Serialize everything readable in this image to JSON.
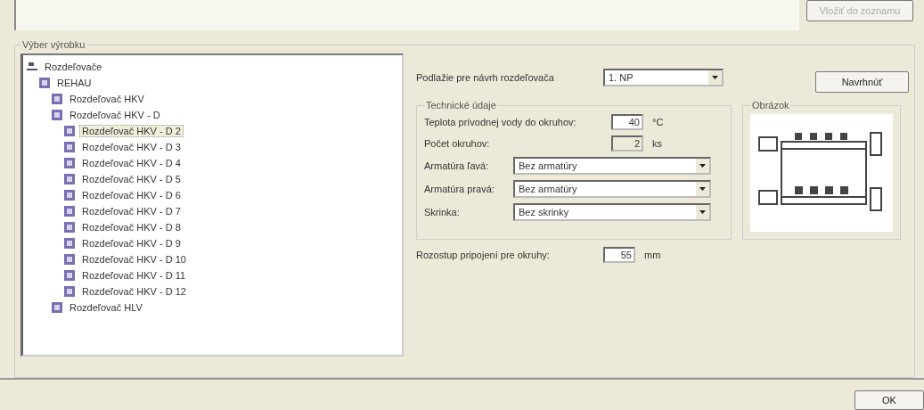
{
  "top_button": {
    "label": "Vložiť do zoznamu",
    "disabled": true
  },
  "product_group": {
    "title": "Výber výrobku"
  },
  "tree": [
    {
      "label": "Rozdeľovače",
      "selected": false,
      "children": [
        {
          "label": "REHAU",
          "selected": false,
          "children": [
            {
              "label": "Rozdeľovač HKV",
              "selected": false
            },
            {
              "label": "Rozdeľovač HKV - D",
              "selected": false,
              "children": [
                {
                  "label": "Rozdeľovač HKV - D 2",
                  "selected": true
                },
                {
                  "label": "Rozdeľovač HKV - D 3",
                  "selected": false
                },
                {
                  "label": "Rozdeľovač HKV - D 4",
                  "selected": false
                },
                {
                  "label": "Rozdeľovač HKV - D 5",
                  "selected": false
                },
                {
                  "label": "Rozdeľovač HKV - D 6",
                  "selected": false
                },
                {
                  "label": "Rozdeľovač HKV - D 7",
                  "selected": false
                },
                {
                  "label": "Rozdeľovač HKV - D 8",
                  "selected": false
                },
                {
                  "label": "Rozdeľovač HKV - D 9",
                  "selected": false
                },
                {
                  "label": "Rozdeľovač HKV - D 10",
                  "selected": false
                },
                {
                  "label": "Rozdeľovač HKV - D 11",
                  "selected": false
                },
                {
                  "label": "Rozdeľovač HKV - D 12",
                  "selected": false
                }
              ]
            },
            {
              "label": "Rozdeľovač HLV",
              "selected": false
            }
          ]
        }
      ]
    }
  ],
  "floor": {
    "label": "Podlažie pre návrh rozdeľovača",
    "value": "1. NP"
  },
  "propose_button": {
    "label": "Navrhnúť"
  },
  "tech_group": {
    "title": "Technické údaje",
    "fields": [
      {
        "kind": "number",
        "label": "Teplota prívodnej vody do okruhov:",
        "value": "40",
        "unit": "°C",
        "disabled": false
      },
      {
        "kind": "number",
        "label": "Počet okruhov:",
        "value": "2",
        "unit": "ks",
        "disabled": true
      },
      {
        "kind": "select",
        "label": "Armatúra ľavá:",
        "value": "Bez armatúry"
      },
      {
        "kind": "select",
        "label": "Armatúra pravá:",
        "value": "Bez armatúry"
      },
      {
        "kind": "select",
        "label": "Skrinka:",
        "value": "Bez skrinky"
      }
    ]
  },
  "picture_group": {
    "title": "Obrázok"
  },
  "spacing": {
    "label": "Rozostup pripojení pre okruhy:",
    "value": "55",
    "unit": "mm"
  },
  "ok_button": {
    "label": "OK"
  }
}
